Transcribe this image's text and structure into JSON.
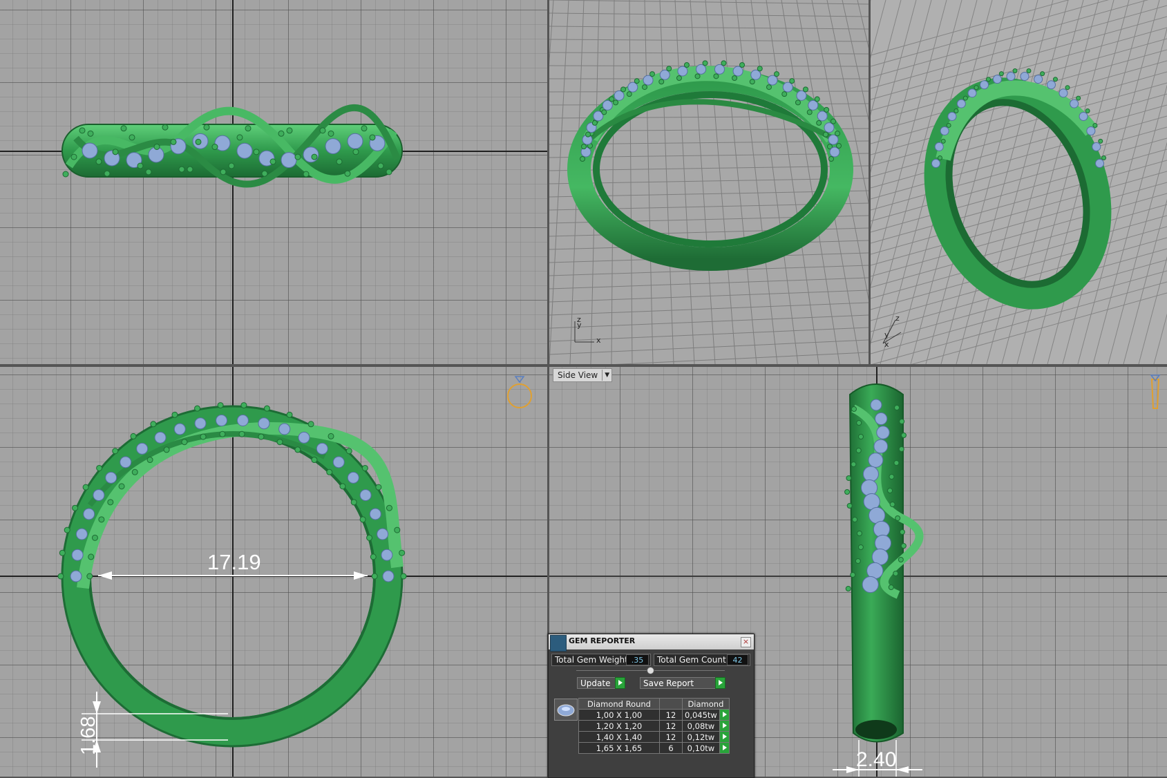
{
  "views": {
    "side_view_label": "Side View"
  },
  "dimensions": {
    "inner_diameter": "17.19",
    "band_thickness": "1.68",
    "band_width": "2.40"
  },
  "axes": {
    "persp1": {
      "z": "z",
      "y": "y",
      "x": "x"
    },
    "persp2": {
      "z": "z",
      "y": "y",
      "x": "x"
    }
  },
  "gem_reporter": {
    "title": "GEM REPORTER",
    "close_symbol": "×",
    "total_weight_label": "Total Gem Weight",
    "total_weight_value": ".35",
    "total_count_label": "Total Gem Count",
    "total_count_value": "42",
    "update_label": "Update",
    "save_report_label": "Save Report",
    "table_headers": [
      "Diamond Round",
      "",
      "Diamond"
    ],
    "rows": [
      {
        "size": "1,00 X 1,00",
        "count": "12",
        "weight": "0,045tw"
      },
      {
        "size": "1,20 X 1,20",
        "count": "12",
        "weight": "0,08tw"
      },
      {
        "size": "1,40 X 1,40",
        "count": "12",
        "weight": "0,12tw"
      },
      {
        "size": "1,65 X 1,65",
        "count": "6",
        "weight": "0,10tw"
      }
    ]
  },
  "colors": {
    "ring_green": "#2f9a4c",
    "gem_blue": "#8fa9d6",
    "viewport_grey": "#a3a3a3",
    "indicator_orange": "#e0a030"
  }
}
